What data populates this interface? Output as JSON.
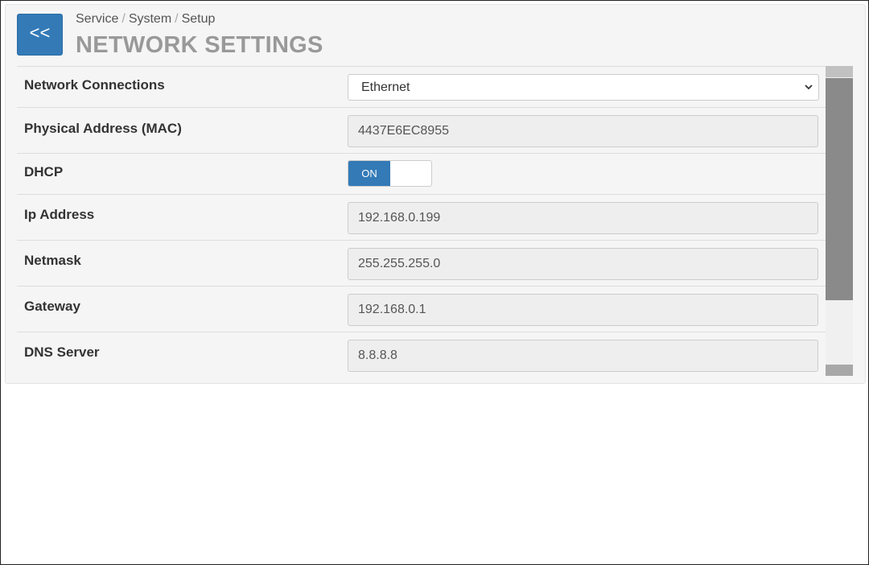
{
  "header": {
    "back_label": "<<",
    "breadcrumb": [
      "Service",
      "System",
      "Setup"
    ],
    "breadcrumb_separator": "/",
    "title": "NETWORK SETTINGS"
  },
  "settings": {
    "network_connections": {
      "label": "Network Connections",
      "value": "Ethernet"
    },
    "mac": {
      "label": "Physical Address (MAC)",
      "value": "4437E6EC8955"
    },
    "dhcp": {
      "label": "DHCP",
      "toggle_label": "ON",
      "state": "on"
    },
    "ip": {
      "label": "Ip Address",
      "value": "192.168.0.199"
    },
    "netmask": {
      "label": "Netmask",
      "value": "255.255.255.0"
    },
    "gateway": {
      "label": "Gateway",
      "value": "192.168.0.1"
    },
    "dns": {
      "label": "DNS Server",
      "value": "8.8.8.8"
    }
  },
  "colors": {
    "accent": "#337ab7",
    "title_gray": "#999999",
    "panel_bg": "#f5f5f5",
    "field_bg": "#eeeeee"
  }
}
